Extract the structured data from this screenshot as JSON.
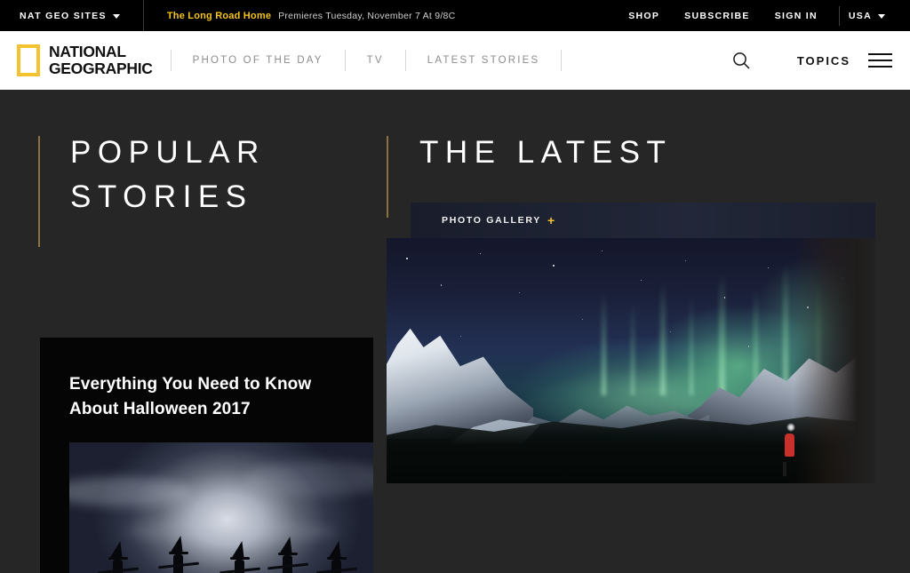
{
  "topbar": {
    "sites_label": "NAT GEO SITES",
    "sites_caret": "chevron-down-icon",
    "promo_title": "The Long Road Home",
    "promo_subtitle": "Premieres Tuesday, November 7 At 9/8C",
    "links": [
      {
        "label": "SHOP"
      },
      {
        "label": "SUBSCRIBE"
      },
      {
        "label": "SIGN IN"
      }
    ],
    "region_label": "USA"
  },
  "header": {
    "logo_line1": "NATIONAL",
    "logo_line2": "GEOGRAPHIC",
    "nav": [
      {
        "label": "PHOTO OF THE DAY"
      },
      {
        "label": "TV"
      },
      {
        "label": "LATEST STORIES"
      }
    ],
    "search_icon": "search-icon",
    "topics_label": "TOPICS",
    "menu_icon": "hamburger-menu-icon"
  },
  "sections": {
    "popular": {
      "title": "POPULAR\nSTORIES",
      "story": {
        "headline": "Everything You Need to Know About Halloween 2017"
      }
    },
    "latest": {
      "title": "THE LATEST",
      "gallery_label": "PHOTO GALLERY",
      "gallery_plus": "+"
    }
  },
  "colors": {
    "brand_yellow": "#f2c230",
    "accent_rule": "#8a7340",
    "promo_gold": "#f5c518",
    "page_bg": "#262626",
    "topbar_bg": "#000000",
    "header_bg": "#ffffff"
  }
}
